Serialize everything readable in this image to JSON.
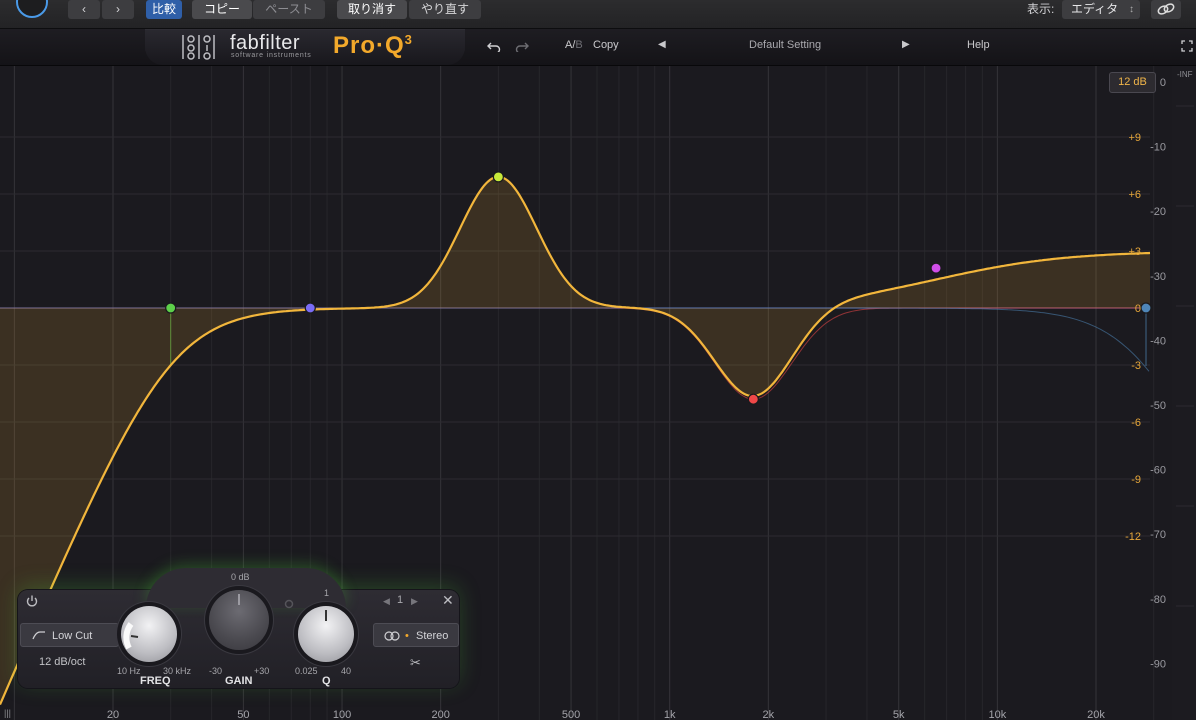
{
  "host": {
    "compare_label": "比較",
    "copy_label": "コピー",
    "paste_label": "ペースト",
    "undo_label": "取り消す",
    "redo_label": "やり直す",
    "view_label": "表示:",
    "view_value": "エディタ"
  },
  "header": {
    "brand": "fabfilter",
    "brand_sub": "software instruments",
    "product": "Pro·Q",
    "product_version": "3",
    "ab_label": "A/",
    "ab_b": "B",
    "copy_label": "Copy",
    "preset_name": "Default Setting",
    "help_label": "Help"
  },
  "range_badge": "12 dB",
  "inf_label": "-INF",
  "gain_scale": [
    "+9",
    "+6",
    "+3",
    "0",
    "-3",
    "-6",
    "-9",
    "-12"
  ],
  "db_scale": [
    "0",
    "-10",
    "-20",
    "-30",
    "-40",
    "-50",
    "-60",
    "-70",
    "-80",
    "-90"
  ],
  "freq_labels": [
    "20",
    "50",
    "100",
    "200",
    "500",
    "1k",
    "2k",
    "5k",
    "10k",
    "20k"
  ],
  "colors": {
    "curve": "#f2b63c",
    "band_lowcut": "#5dd04a",
    "band_shelf": "#7a6cf5",
    "band_peak": "#c7ea3a",
    "band_dip": "#f04848",
    "band_highshelf": "#d04ee8",
    "band_hicut": "#4f86b8"
  },
  "bands": [
    {
      "name": "low-cut",
      "freq": 30,
      "gain": 0,
      "color": "#5dd04a"
    },
    {
      "name": "low-shelf",
      "freq": 80,
      "gain": 0,
      "color": "#7a6cf5"
    },
    {
      "name": "bell-boost",
      "freq": 300,
      "gain": 6.9,
      "color": "#c7ea3a"
    },
    {
      "name": "bell-cut",
      "freq": 1800,
      "gain": -4.8,
      "color": "#f04848"
    },
    {
      "name": "high-shelf",
      "freq": 6500,
      "gain": 2.1,
      "color": "#d04ee8"
    },
    {
      "name": "high-cut",
      "freq": 28000,
      "gain": 0,
      "color": "#4f86b8"
    }
  ],
  "band_panel": {
    "type_label": "Low Cut",
    "slope_label": "12 dB/oct",
    "freq_title": "FREQ",
    "freq_min": "10 Hz",
    "freq_max": "30 kHz",
    "gain_title": "GAIN",
    "gain_top": "0 dB",
    "gain_min": "-30",
    "gain_max": "+30",
    "q_title": "Q",
    "q_top": "1",
    "q_min": "0.025",
    "q_max": "40",
    "band_number": "1",
    "stereo_label": "Stereo"
  }
}
